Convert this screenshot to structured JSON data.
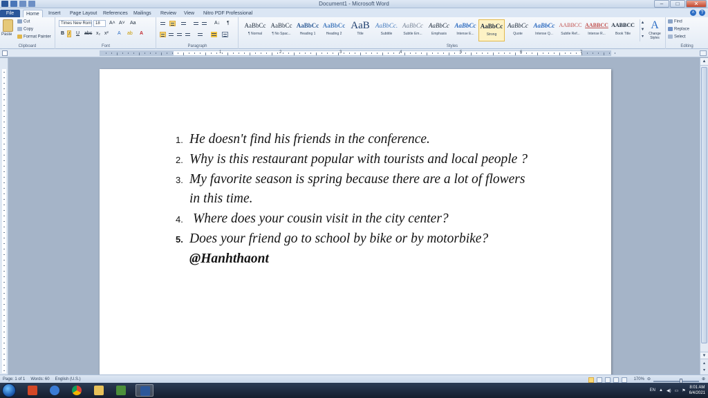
{
  "window": {
    "title": "Document1 - Microsoft Word"
  },
  "tabs": [
    {
      "label": "File"
    },
    {
      "label": "Home"
    },
    {
      "label": "Insert"
    },
    {
      "label": "Page Layout"
    },
    {
      "label": "References"
    },
    {
      "label": "Mailings"
    },
    {
      "label": "Review"
    },
    {
      "label": "View"
    },
    {
      "label": "Nitro PDF Professional"
    }
  ],
  "ribbon": {
    "clipboard": {
      "paste": "Paste",
      "cut": "Cut",
      "copy": "Copy",
      "format_painter": "Format Painter",
      "label": "Clipboard"
    },
    "font": {
      "name": "Times New Rom",
      "size": "18",
      "label": "Font",
      "bold": "B",
      "italic": "I",
      "underline": "U",
      "strike": "abc",
      "sub": "x₂",
      "sup": "x²",
      "grow": "A˄",
      "shrink": "A˅",
      "case": "Aa",
      "color": "A"
    },
    "paragraph": {
      "label": "Paragraph",
      "pilcrow": "¶",
      "sort": "A↓"
    },
    "styles": {
      "label": "Styles",
      "items": [
        {
          "sample": "AaBbCc",
          "name": "¶ Normal"
        },
        {
          "sample": "AaBbCc",
          "name": "¶ No Spac..."
        },
        {
          "sample": "AaBbCc",
          "name": "Heading 1"
        },
        {
          "sample": "AaBbCc",
          "name": "Heading 2"
        },
        {
          "sample": "AaB",
          "name": "Title"
        },
        {
          "sample": "AaBbCc.",
          "name": "Subtitle"
        },
        {
          "sample": "AaBbCc",
          "name": "Subtle Em..."
        },
        {
          "sample": "AaBbCc",
          "name": "Emphasis"
        },
        {
          "sample": "AaBbCc",
          "name": "Intense E..."
        },
        {
          "sample": "AaBbCc",
          "name": "Strong"
        },
        {
          "sample": "AaBbCc",
          "name": "Quote"
        },
        {
          "sample": "AaBbCc",
          "name": "Intense Q..."
        },
        {
          "sample": "AABBCC",
          "name": "Subtle Ref..."
        },
        {
          "sample": "AABBCC",
          "name": "Intense R..."
        },
        {
          "sample": "AABBCC",
          "name": "Book Title"
        }
      ],
      "change_styles": "Change Styles"
    },
    "editing": {
      "label": "Editing",
      "find": "Find",
      "replace": "Replace",
      "select": "Select"
    }
  },
  "ruler": {
    "numbers": [
      "1",
      "2",
      "3",
      "4",
      "5",
      "6",
      "7"
    ]
  },
  "document": {
    "items": [
      {
        "num": "1.",
        "text": "He doesn't find his friends in the conference."
      },
      {
        "num": "2.",
        "text": "Why is this restaurant popular with tourists and local people ?"
      },
      {
        "num": "3.",
        "text": "My favorite season is spring because there are a lot of flowers in this time."
      },
      {
        "num": "4.",
        "text": "Where does your cousin visit in the city center?"
      },
      {
        "num": "5.",
        "text": "Does your friend go to school by bike or by motorbike?"
      }
    ],
    "signature": "@Hanhthaont"
  },
  "statusbar": {
    "page": "Page: 1 of 1",
    "words": "Words: 60",
    "language": "English (U.S.)",
    "zoom": "170%"
  },
  "taskbar": {
    "lang": "EN",
    "time": "8:01 AM",
    "date": "6/4/2021"
  }
}
